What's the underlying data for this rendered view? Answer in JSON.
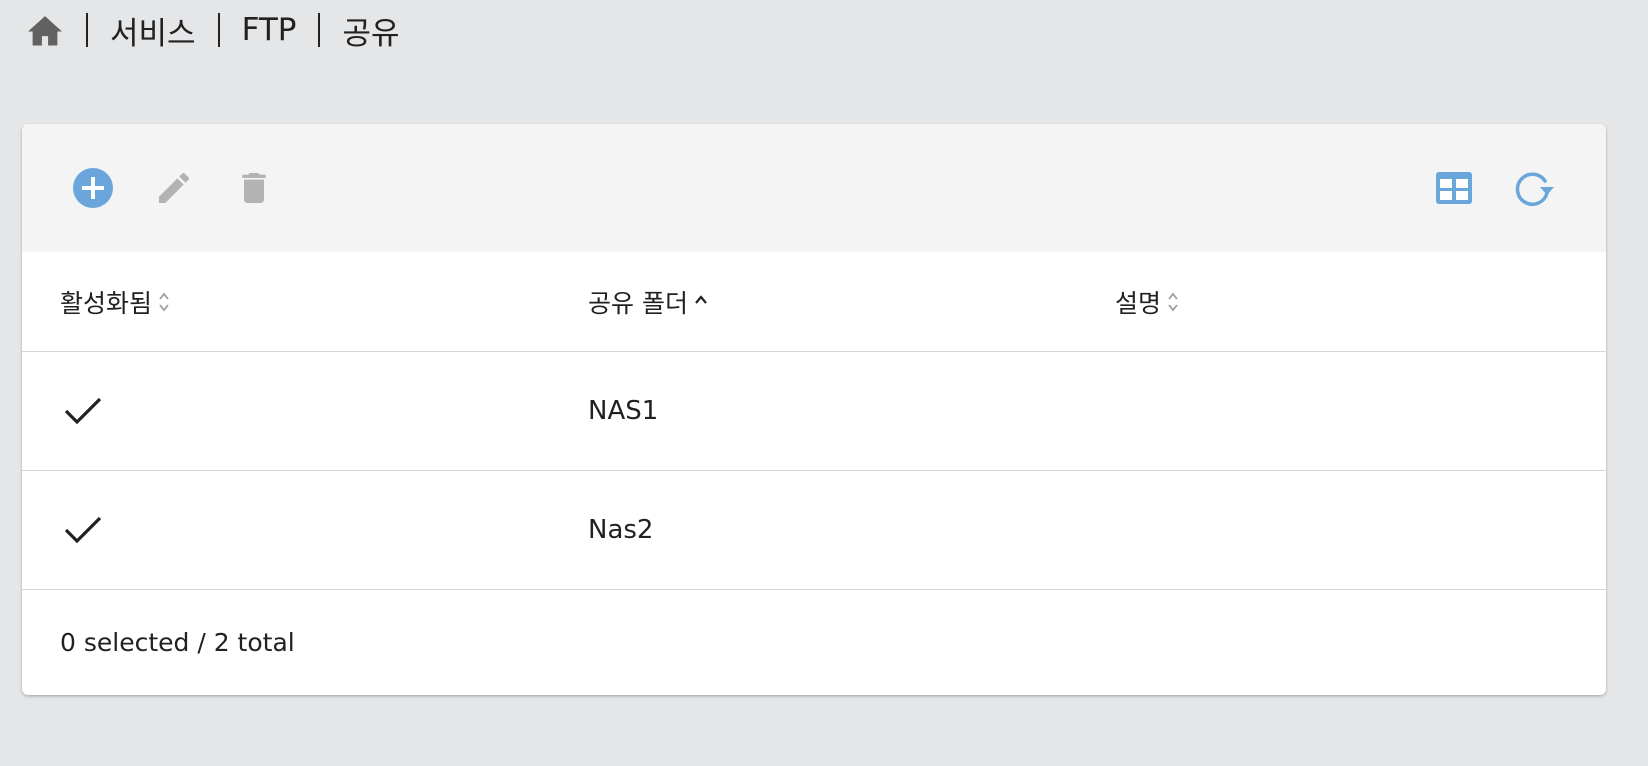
{
  "breadcrumb": {
    "home_icon": "home-icon",
    "items": [
      "서비스",
      "FTP",
      "공유"
    ]
  },
  "toolbar": {
    "add_icon": "plus-circle-icon",
    "edit_icon": "pencil-icon",
    "delete_icon": "trash-icon",
    "columns_icon": "table-columns-icon",
    "refresh_icon": "refresh-icon",
    "accent_color": "#6aa6db",
    "disabled_color": "#b3b3b3"
  },
  "table": {
    "columns": [
      {
        "label": "활성화됨",
        "sort": "none"
      },
      {
        "label": "공유 폴더",
        "sort": "ascending"
      },
      {
        "label": "설명",
        "sort": "none"
      }
    ],
    "rows": [
      {
        "enabled": true,
        "folder": "NAS1",
        "description": ""
      },
      {
        "enabled": true,
        "folder": "Nas2",
        "description": ""
      }
    ]
  },
  "footer": {
    "status": "0 selected / 2 total"
  }
}
